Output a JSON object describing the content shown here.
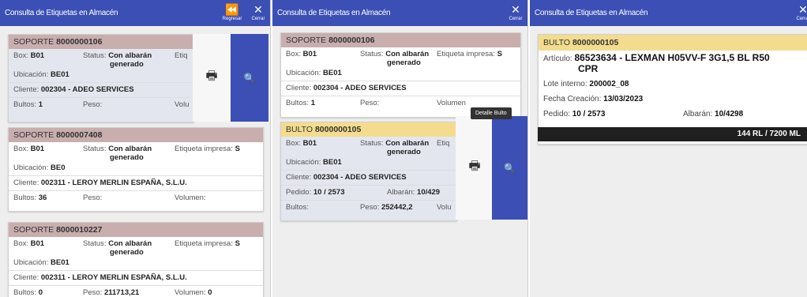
{
  "app_title": "Consulta de Etiquetas en Almacén",
  "topbar": {
    "back_label": "Regresar",
    "close_label": "Cerrar"
  },
  "labels": {
    "box": "Box:",
    "status": "Status:",
    "etiqueta_full": "Etiqueta impresa:",
    "etiqueta_trunc": "Etiq",
    "ubicacion": "Ubicación:",
    "cliente": "Cliente:",
    "bultos": "Bultos:",
    "peso": "Peso:",
    "volumen": "Volumen:",
    "volu_trunc": "Volu",
    "volumen_trunc": "Volumen",
    "pedido": "Pedido:",
    "albaran": "Albarán:",
    "articulo": "Artículo:",
    "lote": "Lote interno:",
    "fecha": "Fecha Creación:"
  },
  "panel1": {
    "cards": [
      {
        "type": "SOPORTE",
        "number": "8000000106",
        "box": "B01",
        "status": "Con albarán",
        "status2": "generado",
        "etiqueta": "",
        "ubicacion": "BE01",
        "cliente": "002304 - ADEO SERVICES",
        "bultos": "1",
        "peso": "",
        "volumen": ""
      },
      {
        "type": "SOPORTE",
        "number": "8000007408",
        "box": "B01",
        "status": "Con albarán",
        "status2": "generado",
        "etiqueta": "S",
        "ubicacion": "BE0",
        "cliente": "002311 - LEROY MERLIN ESPAÑA, S.L.U.",
        "bultos": "36",
        "peso": "",
        "volumen": ""
      },
      {
        "type": "SOPORTE",
        "number": "8000010227",
        "box": "B01",
        "status": "Con albarán",
        "status2": "generado",
        "etiqueta": "S",
        "ubicacion": "BE01",
        "cliente": "002311 - LEROY MERLIN ESPAÑA, S.L.U.",
        "bultos": "0",
        "peso": "211713,21",
        "volumen": "0"
      }
    ]
  },
  "panel2": {
    "soporte": {
      "type": "SOPORTE",
      "number": "8000000106",
      "box": "B01",
      "status": "Con albarán",
      "status2": "generado",
      "etiqueta": "S",
      "ubicacion": "BE01",
      "cliente": "002304 - ADEO SERVICES",
      "bultos": "1",
      "peso": "",
      "volumen": ""
    },
    "bulto": {
      "type": "BULTO",
      "number": "8000000105",
      "box": "B01",
      "status": "Con albarán",
      "status2": "generado",
      "ubicacion": "BE01",
      "cliente": "002304 - ADEO SERVICES",
      "pedido": "10 / 2573",
      "albaran": "10/429",
      "bultos": "",
      "peso": "252442,2"
    },
    "tooltip": "Detalle Bulto"
  },
  "panel3": {
    "bulto": {
      "type": "BULTO",
      "number": "8000000105",
      "articulo": "86523634 - LEXMAN H05VV-F 3G1,5 BL R50",
      "articulo2": "CPR",
      "lote": "200002_08",
      "fecha": "13/03/2023",
      "pedido": "10 / 2573",
      "albaran": "10/4298",
      "cantidad": "144 RL / 7200 ML"
    }
  },
  "icons": {
    "back": "⏪",
    "close": "✕",
    "print": "🖶",
    "search": "🔍"
  },
  "colors": {
    "topbar": "#3b4fb5",
    "soporte_header": "#c9aeae",
    "bulto_header": "#f3dc8d",
    "search_button": "#3b4fb5"
  }
}
